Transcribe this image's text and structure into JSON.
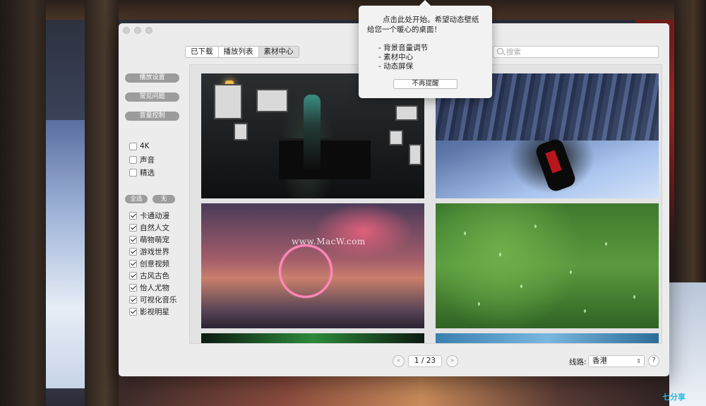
{
  "window": {
    "tabs": [
      {
        "label": "已下载"
      },
      {
        "label": "播放列表"
      },
      {
        "label": "素材中心",
        "active": true
      }
    ],
    "search_placeholder": "搜索"
  },
  "sidebar": {
    "buttons": [
      {
        "label": "播放设置"
      },
      {
        "label": "常见问题"
      },
      {
        "label": "音量控制"
      }
    ],
    "filters": [
      {
        "label": "4K",
        "checked": false
      },
      {
        "label": "声音",
        "checked": false
      },
      {
        "label": "精选",
        "checked": false
      }
    ],
    "select_all_label": "全选",
    "select_none_label": "无",
    "categories": [
      {
        "label": "卡通动漫",
        "checked": true
      },
      {
        "label": "自然人文",
        "checked": true
      },
      {
        "label": "萌物萌宠",
        "checked": true
      },
      {
        "label": "游戏世界",
        "checked": true
      },
      {
        "label": "创意视频",
        "checked": true
      },
      {
        "label": "古风古色",
        "checked": true
      },
      {
        "label": "怡人尤物",
        "checked": true
      },
      {
        "label": "可视化音乐",
        "checked": true
      },
      {
        "label": "影视明星",
        "checked": true
      }
    ]
  },
  "gallery": {
    "watermark": "www.MacW.com"
  },
  "pager": {
    "prev_icon": "«",
    "next_icon": "»",
    "page_text": "1 / 23"
  },
  "route": {
    "label": "线路:",
    "selected": "香港"
  },
  "help_label": "?",
  "popover": {
    "line1": "点击此处开始。希望动态壁纸",
    "line2": "给您一个暖心的桌面！",
    "item1": "- 背景音量调节",
    "item2": "- 素材中心",
    "item3": "- 动态屏保",
    "button": "不再提醒"
  },
  "desktop_watermark": "七分享"
}
